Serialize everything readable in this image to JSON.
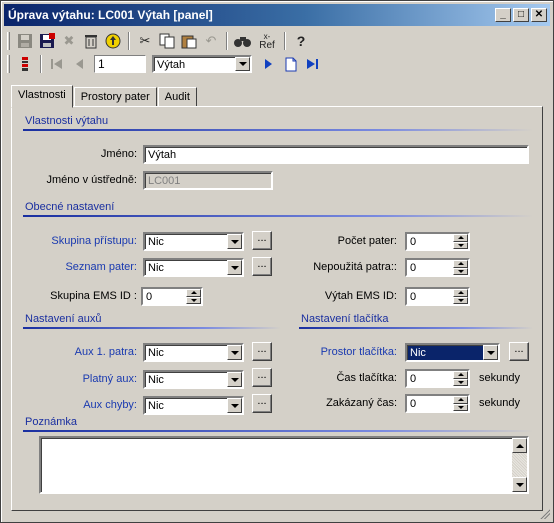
{
  "window": {
    "title": "Úprava výtahu: LC001 Výtah  [panel]"
  },
  "toolbar": {
    "icons": [
      "save-icon",
      "save-as-icon",
      "delete-x-icon",
      "trash-icon",
      "refresh-icon",
      "cut-icon",
      "copy-icon",
      "paste-icon",
      "undo-icon",
      "find-icon",
      "ref-icon",
      "help-icon"
    ],
    "ref_label": "Ref",
    "help_label": "?",
    "record_number": "1",
    "record_combo": "Výtah"
  },
  "tabs": [
    {
      "label": "Vlastnosti",
      "active": true
    },
    {
      "label": "Prostory pater",
      "active": false
    },
    {
      "label": "Audit",
      "active": false
    }
  ],
  "sections": {
    "lift_props": "Vlastnosti výtahu",
    "general": "Obecné nastavení",
    "aux": "Nastavení auxů",
    "button": "Nastavení tlačítka",
    "note": "Poznámka"
  },
  "fields": {
    "name_label": "Jméno:",
    "name_value": "Výtah",
    "central_name_label": "Jméno v ústředně:",
    "central_name_value": "LC001",
    "access_group_label": "Skupina přístupu:",
    "access_group_value": "Nic",
    "floor_list_label": "Seznam pater:",
    "floor_list_value": "Nic",
    "ems_group_label": "Skupina EMS ID :",
    "ems_group_value": "0",
    "floor_count_label": "Počet pater:",
    "floor_count_value": "0",
    "unused_floors_label": "Nepoužitá patra::",
    "unused_floors_value": "0",
    "lift_ems_label": "Výtah EMS ID:",
    "lift_ems_value": "0",
    "aux1_label": "Aux 1. patra:",
    "aux1_value": "Nic",
    "valid_aux_label": "Platný aux:",
    "valid_aux_value": "Nic",
    "error_aux_label": "Aux chyby:",
    "error_aux_value": "Nic",
    "button_space_label": "Prostor tlačítka:",
    "button_space_value": "Nic",
    "button_time_label": "Čas tlačítka:",
    "button_time_value": "0",
    "button_time_unit": "sekundy",
    "disabled_time_label": "Zakázaný čas:",
    "disabled_time_value": "0",
    "disabled_time_unit": "sekundy",
    "ellipsis": "..."
  },
  "window_buttons": {
    "minimize": "_",
    "maximize": "□",
    "close": "✕"
  }
}
